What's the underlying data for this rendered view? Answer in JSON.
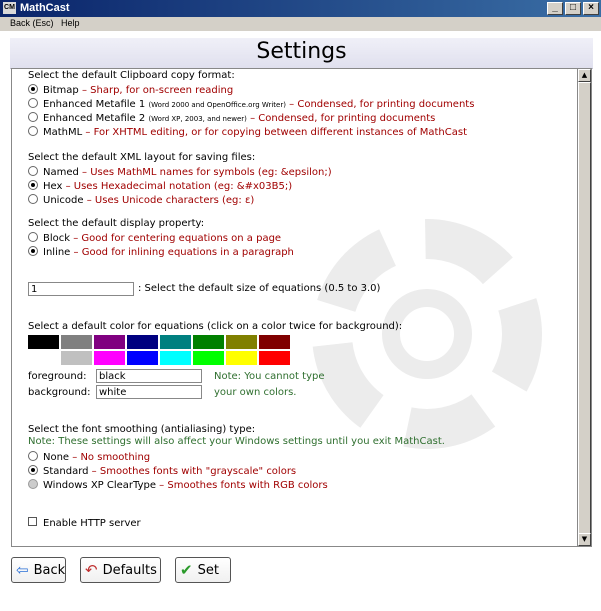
{
  "window": {
    "app_icon": "CM",
    "title": "MathCast",
    "controls": [
      "_",
      "□",
      "×"
    ]
  },
  "menu": {
    "back": "Back (Esc)",
    "help": "Help"
  },
  "page": {
    "title": "Settings"
  },
  "clipboard": {
    "heading": "Select the default Clipboard copy format:",
    "options": [
      {
        "label": "Bitmap",
        "sep": " – ",
        "desc": "Sharp, for on-screen reading",
        "note": "",
        "selected": true
      },
      {
        "label": "Enhanced Metafile 1",
        "sep": " ",
        "note": "(Word 2000 and OpenOffice.org Writer)",
        "desc": " – Condensed, for printing documents",
        "selected": false
      },
      {
        "label": "Enhanced Metafile 2",
        "sep": " ",
        "note": "(Word XP, 2003, and newer)",
        "desc": " – Condensed, for printing documents",
        "selected": false
      },
      {
        "label": "MathML",
        "sep": " – ",
        "desc": "For XHTML editing, or for copying between different instances of MathCast",
        "note": "",
        "selected": false
      }
    ]
  },
  "xml_layout": {
    "heading": "Select the default XML layout for saving files:",
    "options": [
      {
        "label": "Named",
        "desc": " – Uses MathML names for symbols (eg: &epsilon;)",
        "selected": false
      },
      {
        "label": "Hex",
        "desc": " – Uses Hexadecimal notation (eg: &#x03B5;)",
        "selected": true
      },
      {
        "label": "Unicode",
        "desc": " – Uses Unicode characters (eg: ε)",
        "selected": false
      }
    ]
  },
  "display": {
    "heading": "Select the default display property:",
    "options": [
      {
        "label": "Block",
        "desc": " – Good for centering equations on a page",
        "selected": false
      },
      {
        "label": "Inline",
        "desc": " – Good for inlining equations in a paragraph",
        "selected": true
      }
    ]
  },
  "size": {
    "value": "1",
    "label": ": Select the default size of equations (0.5 to 3.0)"
  },
  "colors": {
    "heading": "Select a default color for equations (click on a color twice for background):",
    "row1": [
      "#000000",
      "#808080",
      "#800080",
      "#000080",
      "#008080",
      "#008000",
      "#808000",
      "#800000"
    ],
    "row2": [
      "#ffffff",
      "#c0c0c0",
      "#ff00ff",
      "#0000ff",
      "#00ffff",
      "#00ff00",
      "#ffff00",
      "#ff0000"
    ],
    "foreground_label": "foreground:",
    "foreground_value": "black",
    "background_label": "background:",
    "background_value": "white",
    "note_line1": "Note: You cannot type",
    "note_line2": "your own colors."
  },
  "smoothing": {
    "heading": "Select the font smoothing (antialiasing) type:",
    "note": "Note: These settings will also affect your Windows settings until you exit MathCast.",
    "options": [
      {
        "label": "None",
        "desc": " – No smoothing",
        "selected": false
      },
      {
        "label": "Standard",
        "desc": " – Smoothes fonts with \"grayscale\" colors",
        "selected": true
      },
      {
        "label": "Windows XP ClearType",
        "desc": " – Smoothes fonts with RGB colors",
        "selected": false
      }
    ]
  },
  "http": {
    "label": "Enable HTTP server",
    "checked": false
  },
  "buttons": {
    "back": {
      "label": "Back",
      "icon": "back-arrow-icon"
    },
    "defaults": {
      "label": "Defaults",
      "icon": "undo-arrow-icon"
    },
    "set": {
      "label": "Set",
      "icon": "checkmark-icon"
    }
  },
  "accent_colors": {
    "description": "#a00000",
    "note": "#2f6f2f",
    "title_bar": "#0a246a"
  }
}
